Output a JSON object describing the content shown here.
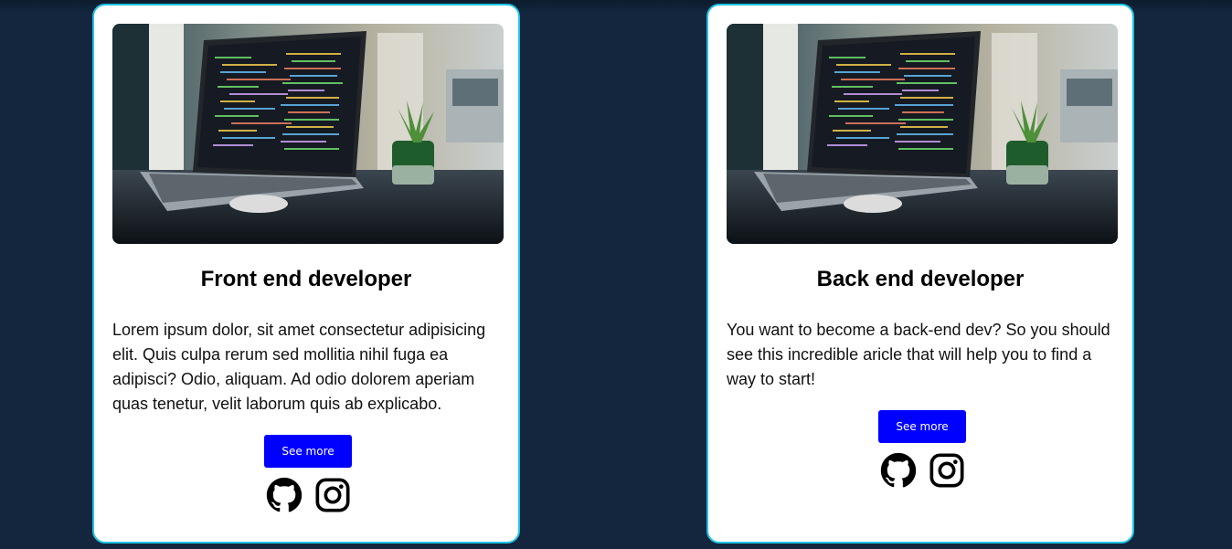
{
  "cards": [
    {
      "title": "Front end developer",
      "description": "Lorem ipsum dolor, sit amet consectetur adipisicing elit. Quis culpa rerum sed mollitia nihil fuga ea adipisci? Odio, aliquam. Ad odio dolorem aperiam quas tenetur, velit laborum quis ab explicabo.",
      "button_label": "See more",
      "icons": [
        "github-icon",
        "instagram-icon"
      ]
    },
    {
      "title": "Back end developer",
      "description": "You want to become a back-end dev? So you should see this incredible aricle that will help you to find a way to start!",
      "button_label": "See more",
      "icons": [
        "github-icon",
        "instagram-icon"
      ]
    }
  ],
  "colors": {
    "page_background": "#13263e",
    "card_border": "#1cc4e4",
    "button": "#0000ff"
  }
}
